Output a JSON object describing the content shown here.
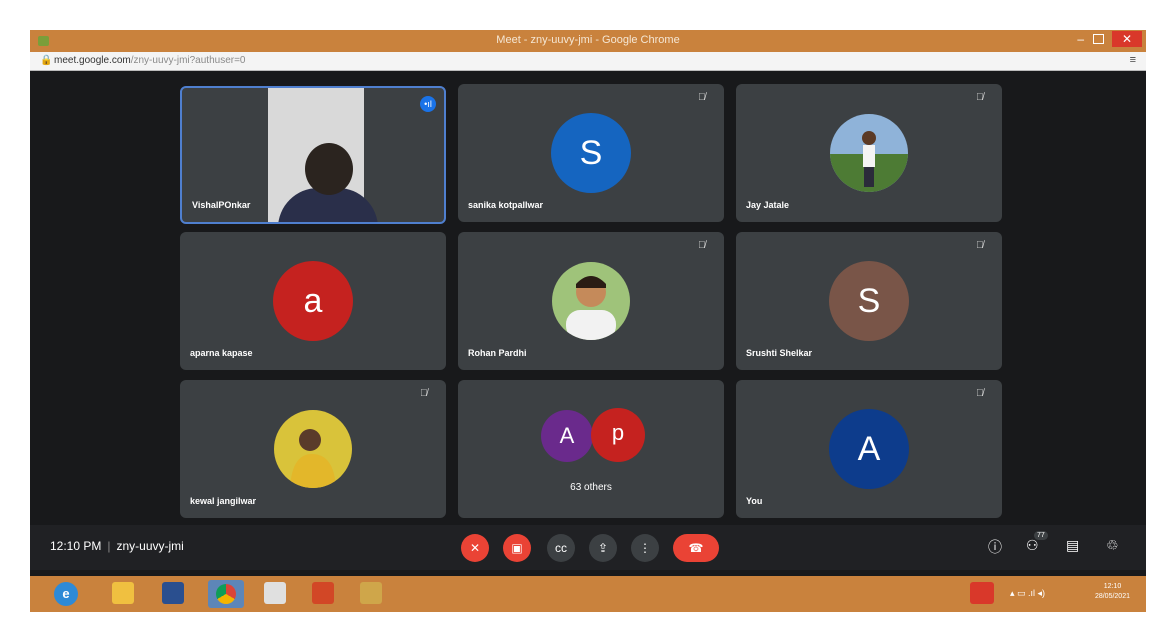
{
  "window": {
    "title": "Meet - zny-uuvy-jmi - Google Chrome"
  },
  "address_bar": {
    "url_host": "meet.google.com",
    "url_path": "/zny-uuvy-jmi?authuser=0"
  },
  "participants": [
    {
      "name": "VishalPOnkar",
      "type": "video",
      "speaking": true
    },
    {
      "name": "sanika kotpallwar",
      "initial": "S",
      "color": "#1565c0"
    },
    {
      "name": "Jay Jatale",
      "type": "photo"
    },
    {
      "name": "aparna kapase",
      "initial": "a",
      "color": "#c5221f"
    },
    {
      "name": "Rohan Pardhi",
      "type": "photo"
    },
    {
      "name": "Srushti Shelkar",
      "initial": "S",
      "color": "#795548"
    },
    {
      "name": "kewal jangilwar",
      "type": "photo"
    },
    {
      "name": "63 others",
      "initials": [
        "A",
        "p"
      ],
      "colors": [
        "#6a2a8c",
        "#c5221f"
      ]
    },
    {
      "name": "You",
      "initial": "A",
      "color": "#0d3c8c"
    }
  ],
  "meeting_bar": {
    "time": "12:10 PM",
    "meeting_code": "zny-uuvy-jmi",
    "participant_count": "77",
    "controls": [
      "mic-off-icon",
      "camera-off-icon",
      "captions-icon",
      "present-icon",
      "more-icon",
      "end-call-icon"
    ],
    "right_icons": [
      "info-icon",
      "people-icon",
      "chat-icon",
      "activities-icon"
    ]
  },
  "taskbar": {
    "start_label": "e",
    "clock_time": "12:10",
    "clock_date": "28/05/2021"
  },
  "colors": {
    "meet_bg": "#202124",
    "tile_bg": "#3c4043",
    "end_call": "#ea4335",
    "accent": "#1a73e8"
  }
}
